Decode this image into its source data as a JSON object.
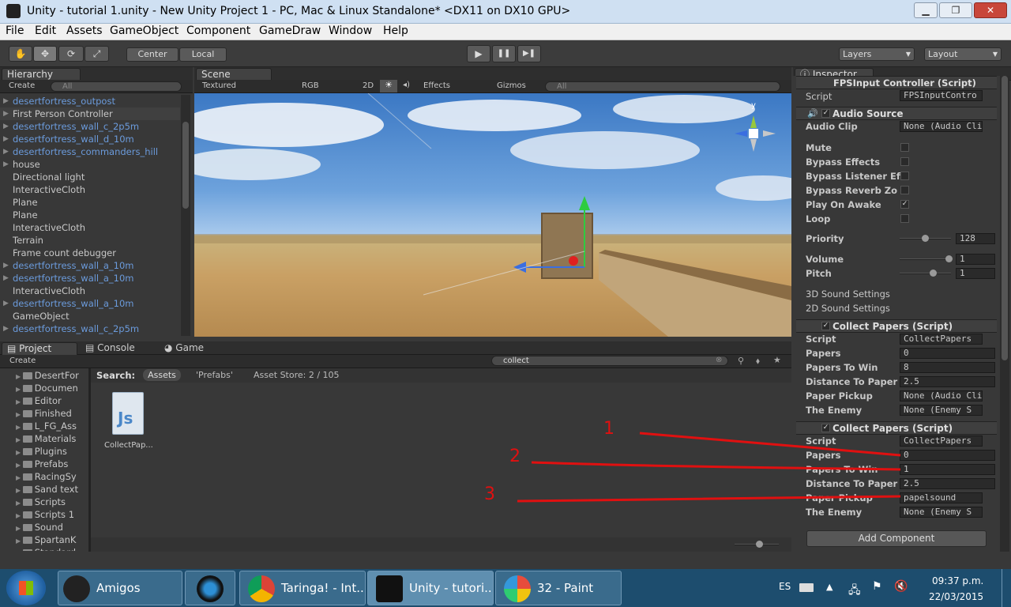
{
  "window": {
    "title": "Unity - tutorial 1.unity - New Unity Project 1 - PC, Mac & Linux Standalone* <DX11 on DX10 GPU>",
    "minimize": "▁",
    "maximize": "❐",
    "close": "✕"
  },
  "menu": [
    "File",
    "Edit",
    "Assets",
    "GameObject",
    "Component",
    "GameDraw",
    "Window",
    "Help"
  ],
  "toolbar": {
    "pivot": "Center",
    "space": "Local",
    "layers": "Layers",
    "layout": "Layout",
    "play": "▶",
    "pause": "❚❚",
    "step": "▶❚"
  },
  "hierarchy": {
    "tab": "Hierarchy",
    "create": "Create",
    "search": "All",
    "items": [
      {
        "label": "desertfortress_outpost",
        "prefab": true,
        "arrow": true,
        "selected": false
      },
      {
        "label": "First Person Controller",
        "prefab": false,
        "arrow": true,
        "selected": true
      },
      {
        "label": "desertfortress_wall_c_2p5m",
        "prefab": true,
        "arrow": true,
        "selected": false
      },
      {
        "label": "desertfortress_wall_d_10m",
        "prefab": true,
        "arrow": true,
        "selected": false
      },
      {
        "label": "desertfortress_commanders_hill",
        "prefab": true,
        "arrow": true,
        "selected": false
      },
      {
        "label": "house",
        "prefab": false,
        "arrow": true,
        "selected": false
      },
      {
        "label": "Directional light",
        "prefab": false,
        "arrow": false,
        "selected": false
      },
      {
        "label": "InteractiveCloth",
        "prefab": false,
        "arrow": false,
        "selected": false
      },
      {
        "label": "Plane",
        "prefab": false,
        "arrow": false,
        "selected": false
      },
      {
        "label": "Plane",
        "prefab": false,
        "arrow": false,
        "selected": false
      },
      {
        "label": "InteractiveCloth",
        "prefab": false,
        "arrow": false,
        "selected": false
      },
      {
        "label": "Terrain",
        "prefab": false,
        "arrow": false,
        "selected": false
      },
      {
        "label": "Frame count debugger",
        "prefab": false,
        "arrow": false,
        "selected": false
      },
      {
        "label": "desertfortress_wall_a_10m",
        "prefab": true,
        "arrow": true,
        "selected": false
      },
      {
        "label": "desertfortress_wall_a_10m",
        "prefab": true,
        "arrow": true,
        "selected": false
      },
      {
        "label": "InteractiveCloth",
        "prefab": false,
        "arrow": false,
        "selected": false
      },
      {
        "label": "desertfortress_wall_a_10m",
        "prefab": true,
        "arrow": true,
        "selected": false
      },
      {
        "label": "GameObject",
        "prefab": false,
        "arrow": false,
        "selected": false
      },
      {
        "label": "desertfortress_wall_c_2p5m",
        "prefab": true,
        "arrow": true,
        "selected": false
      }
    ]
  },
  "scene": {
    "tab": "Scene",
    "shading": "Textured",
    "render": "RGB",
    "mode2d": "2D",
    "effects": "Effects",
    "gizmos": "Gizmos",
    "search": "All",
    "axis_y": "y"
  },
  "project": {
    "tabs": [
      "Project",
      "Console",
      "Game"
    ],
    "create": "Create",
    "search_value": "collect",
    "search_label": "Search:",
    "filters": [
      "Assets",
      "'Prefabs'"
    ],
    "asset_store": "Asset Store: 2 / 105",
    "folders": [
      "DesertFor",
      "Documen",
      "Editor",
      "Finished",
      "L_FG_Ass",
      "Materials",
      "Plugins",
      "Prefabs",
      "RacingSy",
      "Sand text",
      "Scripts",
      "Scripts 1",
      "Sound",
      "SpartanK",
      "Standard"
    ],
    "asset": {
      "label": "CollectPap...",
      "icon_text": "Js"
    }
  },
  "inspector": {
    "tab": "Inspector",
    "fps": {
      "title": "FPSInput Controller (Script)",
      "script_label": "Script",
      "script_value": "FPSInputContro"
    },
    "audio": {
      "title": "Audio Source",
      "clip_label": "Audio Clip",
      "clip_value": "None (Audio Cli",
      "toggles": [
        {
          "label": "Mute",
          "checked": false
        },
        {
          "label": "Bypass Effects",
          "checked": false
        },
        {
          "label": "Bypass Listener Ef",
          "checked": false
        },
        {
          "label": "Bypass Reverb Zo",
          "checked": false
        },
        {
          "label": "Play On Awake",
          "checked": true
        },
        {
          "label": "Loop",
          "checked": false
        }
      ],
      "priority_label": "Priority",
      "priority": "128",
      "volume_label": "Volume",
      "volume": "1",
      "pitch_label": "Pitch",
      "pitch": "1",
      "settings_3d": "3D Sound Settings",
      "settings_2d": "2D Sound Settings"
    },
    "collect1": {
      "title": "Collect Papers (Script)",
      "fields": [
        {
          "label": "Script",
          "value": "CollectPapers"
        },
        {
          "label": "Papers",
          "value": "0"
        },
        {
          "label": "Papers To Win",
          "value": "8"
        },
        {
          "label": "Distance To Paper",
          "value": "2.5"
        },
        {
          "label": "Paper Pickup",
          "value": "None (Audio Cli"
        },
        {
          "label": "The Enemy",
          "value": "None (Enemy S"
        }
      ]
    },
    "collect2": {
      "title": "Collect Papers (Script)",
      "fields": [
        {
          "label": "Script",
          "value": "CollectPapers"
        },
        {
          "label": "Papers",
          "value": "0"
        },
        {
          "label": "Papers To Win",
          "value": "1"
        },
        {
          "label": "Distance To Paper",
          "value": "2.5"
        },
        {
          "label": "Paper Pickup",
          "value": "papelsound"
        },
        {
          "label": "The Enemy",
          "value": "None (Enemy S"
        }
      ]
    },
    "add_component": "Add Component"
  },
  "annotations": [
    "1",
    "2",
    "3"
  ],
  "taskbar": {
    "items": [
      "Amigos",
      "Taringa! - Int...",
      "Unity - tutori...",
      "32 - Paint"
    ],
    "lang": "ES",
    "time": "09:37 p.m.",
    "date": "22/03/2015"
  }
}
